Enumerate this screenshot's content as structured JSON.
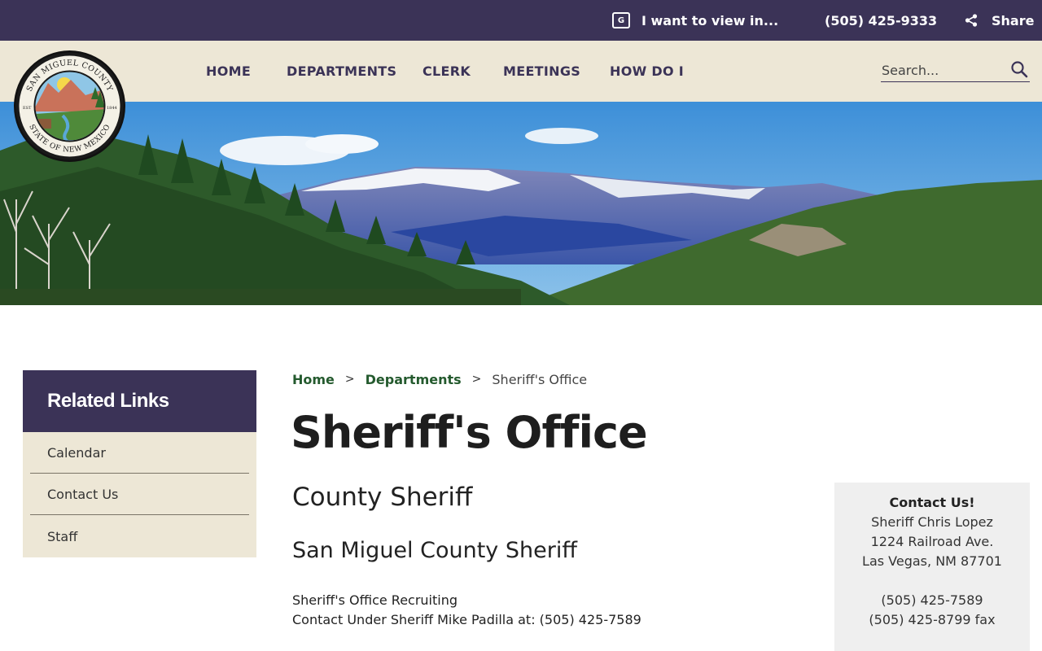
{
  "topbar": {
    "translate_label": "I want to view in...",
    "phone": "(505) 425-9333",
    "share_label": "Share"
  },
  "nav": {
    "items": [
      {
        "label": "HOME"
      },
      {
        "label": "DEPARTMENTS"
      },
      {
        "label": "CLERK"
      },
      {
        "label": "MEETINGS"
      },
      {
        "label": "HOW DO I"
      }
    ],
    "search_placeholder": "Search..."
  },
  "logo": {
    "top_text": "SAN MIGUEL COUNTY",
    "bottom_text": "STATE OF NEW MEXICO",
    "est_left": "EST",
    "est_right": "1844"
  },
  "sidebar": {
    "title": "Related Links",
    "links": [
      {
        "label": "Calendar"
      },
      {
        "label": "Contact Us"
      },
      {
        "label": "Staff"
      }
    ]
  },
  "breadcrumb": {
    "home": "Home",
    "departments": "Departments",
    "current": "Sheriff's Office",
    "separator": ">"
  },
  "main": {
    "title": "Sheriff's Office",
    "heading2": "County Sheriff",
    "heading3": "San Miguel County Sheriff",
    "line1": "Sheriff's Office Recruiting",
    "line2": "Contact Under Sheriff Mike Padilla at: (505) 425-7589"
  },
  "contact": {
    "title": "Contact Us!",
    "name": "Sheriff Chris Lopez",
    "address1": "1224 Railroad Ave.",
    "address2": "Las Vegas, NM 87701",
    "phone": "(505) 425-7589",
    "fax": "(505) 425-8799 fax"
  },
  "colors": {
    "brand_purple": "#3b3357",
    "nav_beige": "#ede7d6",
    "link_green": "#245a2e"
  },
  "icons": {
    "translate": "translate-icon",
    "share": "share-icon",
    "search": "search-icon"
  }
}
